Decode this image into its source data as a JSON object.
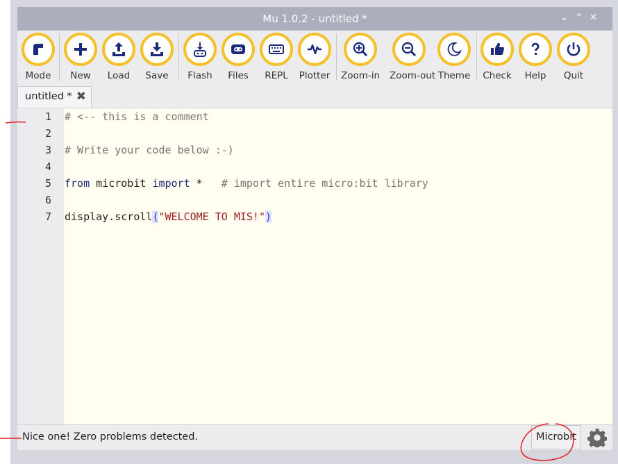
{
  "window": {
    "title": "Mu 1.0.2 - untitled *",
    "controls": [
      "⌄",
      "⌃",
      "✕"
    ]
  },
  "toolbar": {
    "buttons": [
      {
        "label": "Mode",
        "icon": "mode-icon"
      },
      {
        "label": "New",
        "icon": "plus-icon"
      },
      {
        "label": "Load",
        "icon": "upload-icon"
      },
      {
        "label": "Save",
        "icon": "download-icon"
      },
      {
        "label": "Flash",
        "icon": "flash-icon"
      },
      {
        "label": "Files",
        "icon": "microbit-icon"
      },
      {
        "label": "REPL",
        "icon": "keyboard-icon"
      },
      {
        "label": "Plotter",
        "icon": "pulse-icon"
      },
      {
        "label": "Zoom-in",
        "icon": "zoom-in-icon"
      },
      {
        "label": "Zoom-out",
        "icon": "zoom-out-icon"
      },
      {
        "label": "Theme",
        "icon": "moon-icon"
      },
      {
        "label": "Check",
        "icon": "thumbs-up-icon"
      },
      {
        "label": "Help",
        "icon": "question-icon"
      },
      {
        "label": "Quit",
        "icon": "power-icon"
      }
    ],
    "accent_color": "#f4c12a"
  },
  "tab": {
    "name": "untitled *",
    "close": "✖"
  },
  "editor": {
    "line_numbers": [
      "1",
      "2",
      "3",
      "4",
      "5",
      "6",
      "7"
    ],
    "lines": {
      "l1": "# <-- this is a comment",
      "l3": "# Write your code below :-)",
      "l5_from": "from",
      "l5_module": " microbit ",
      "l5_import": "import",
      "l5_star": " *   ",
      "l5_comment": "# import entire micro:bit library",
      "l7_call": "display.scroll",
      "l7_open": "(",
      "l7_string": "\"WELCOME TO MIS!\"",
      "l7_close": ")"
    }
  },
  "status": {
    "message": "Nice one! Zero problems detected.",
    "mode": "Microbit",
    "gear": "gear-icon"
  }
}
